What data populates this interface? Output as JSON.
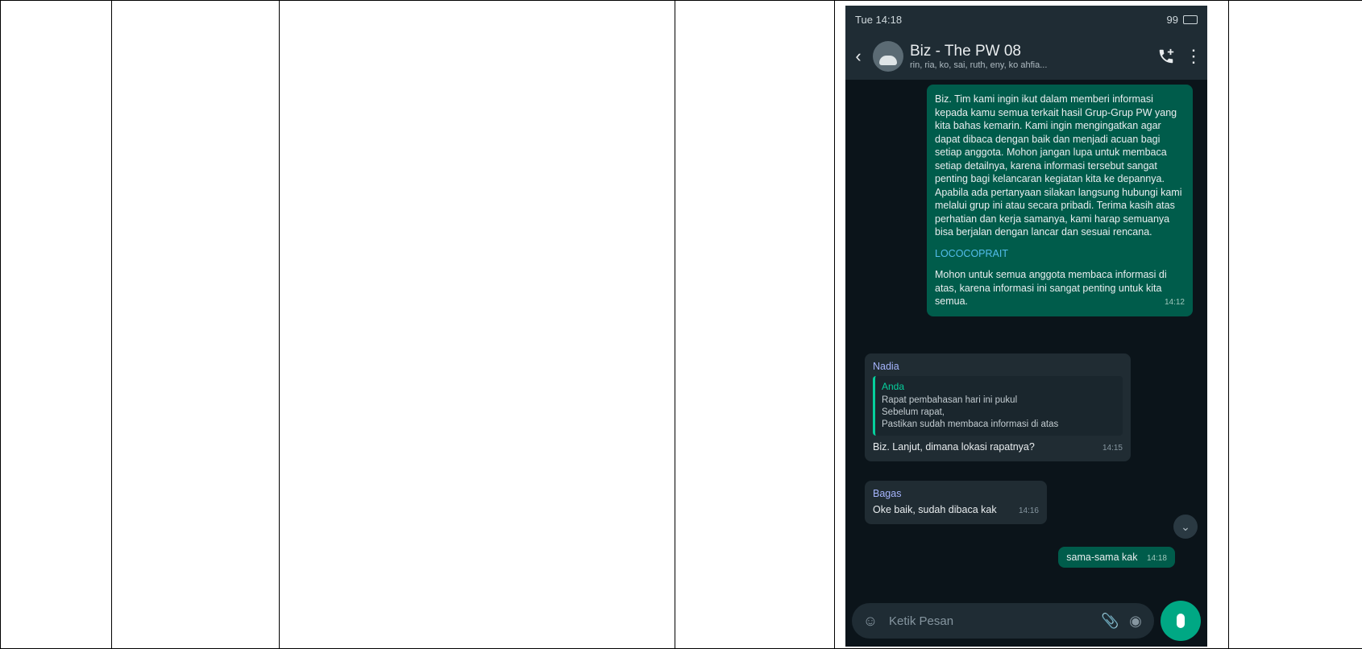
{
  "phone": {
    "status": {
      "carrier_time": "Tue 14:18",
      "battery": "99"
    },
    "header": {
      "title": "Biz - The PW 08",
      "members": "rin, ria, ko, sai, ruth, eny, ko ahfia..."
    },
    "messages": {
      "outgoing_long": {
        "paragraph1": "Biz. Tim kami ingin ikut dalam memberi informasi kepada kamu semua terkait hasil Grup-Grup PW yang kita bahas kemarin. Kami ingin mengingatkan agar dapat dibaca dengan baik dan menjadi acuan bagi setiap anggota. Mohon jangan lupa untuk membaca setiap detailnya, karena informasi tersebut sangat penting bagi kelancaran kegiatan kita ke depannya. Apabila ada pertanyaan silakan langsung hubungi kami melalui grup ini atau secara pribadi. Terima kasih atas perhatian dan kerja samanya, kami harap semuanya bisa berjalan dengan lancar dan sesuai rencana.",
        "link": "LOCOCOPRAIT",
        "paragraph2": "Mohon untuk semua anggota membaca informasi di atas, karena informasi ini sangat penting untuk kita semua.",
        "time": "14:12"
      },
      "incoming_reply": {
        "sender": "Nadia",
        "quote_author": "Anda",
        "quote_lines": [
          "Rapat pembahasan hari ini pukul",
          "Sebelum rapat,",
          "Pastikan sudah membaca informasi di atas"
        ],
        "text": "Biz. Lanjut, dimana lokasi rapatnya?",
        "time": "14:15"
      },
      "incoming_short": {
        "sender": "Bagas",
        "text": "Oke baik, sudah dibaca kak",
        "time": "14:16"
      },
      "outgoing_short": {
        "text": "sama-sama kak",
        "time": "14:18"
      }
    },
    "input": {
      "placeholder": "Ketik Pesan"
    }
  }
}
